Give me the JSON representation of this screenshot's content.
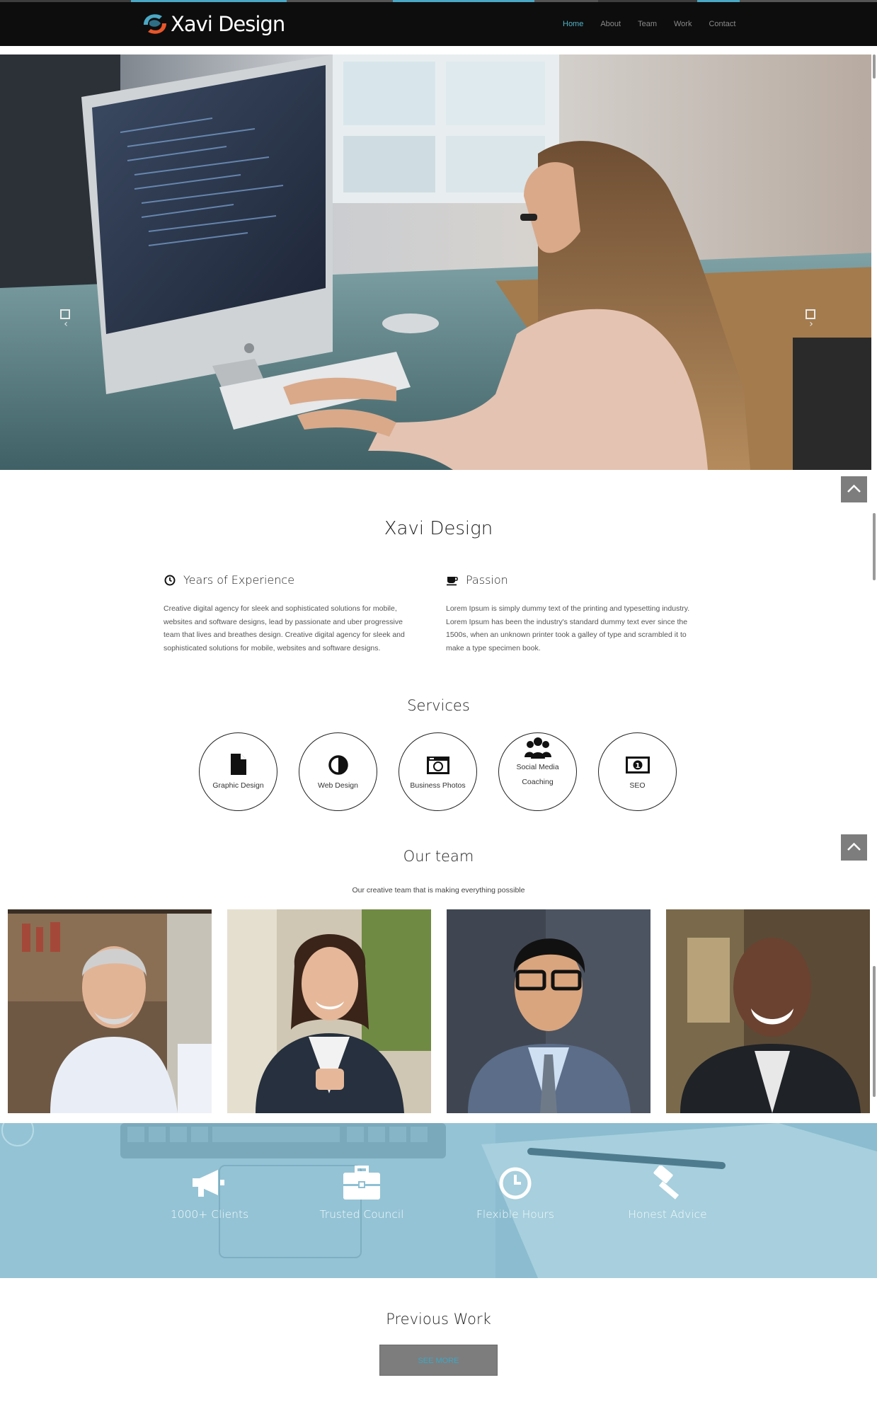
{
  "brand": {
    "name": "Xavi Design",
    "accent": "#4fb3c7",
    "logo_colors": [
      "#4aa8c4",
      "#e8562a"
    ]
  },
  "nav": {
    "items": [
      {
        "label": "Home",
        "active": true
      },
      {
        "label": "About",
        "active": false
      },
      {
        "label": "Team",
        "active": false
      },
      {
        "label": "Work",
        "active": false
      },
      {
        "label": "Contact",
        "active": false
      }
    ]
  },
  "hero": {
    "prev_icon": "chevron-left-icon",
    "next_icon": "chevron-right-icon"
  },
  "about": {
    "title": "Xavi Design",
    "columns": [
      {
        "icon": "clock-icon",
        "heading": "Years of Experience",
        "text": "Creative digital agency for sleek and sophisticated solutions for mobile, websites and software designs, lead by passionate and uber progressive team that lives and breathes design. Creative digital agency for sleek and sophisticated solutions for mobile, websites and software designs."
      },
      {
        "icon": "coffee-icon",
        "heading": "Passion",
        "text": "Lorem Ipsum is simply dummy text of the printing and typesetting industry. Lorem Ipsum has been the industry's standard dummy text ever since the 1500s, when an unknown printer took a galley of type and scrambled it to make a type specimen book."
      }
    ]
  },
  "services": {
    "title": "Services",
    "items": [
      {
        "icon": "file-icon",
        "label": "Graphic Design"
      },
      {
        "icon": "contrast-icon",
        "label": "Web Design"
      },
      {
        "icon": "camera-icon",
        "label": "Business Photos"
      },
      {
        "icon": "users-icon",
        "label": "Social Media Coaching"
      },
      {
        "icon": "money-icon",
        "label": "SEO"
      }
    ]
  },
  "team": {
    "title": "Our team",
    "subtitle": "Our creative team that is making everything possible"
  },
  "features": {
    "items": [
      {
        "icon": "bullhorn-icon",
        "label": "1000+ Clients"
      },
      {
        "icon": "briefcase-icon",
        "label": "Trusted Council"
      },
      {
        "icon": "clock-icon",
        "label": "Flexible Hours"
      },
      {
        "icon": "gavel-icon",
        "label": "Honest Advice"
      }
    ]
  },
  "work": {
    "title": "Previous Work",
    "button_label": "See more"
  }
}
